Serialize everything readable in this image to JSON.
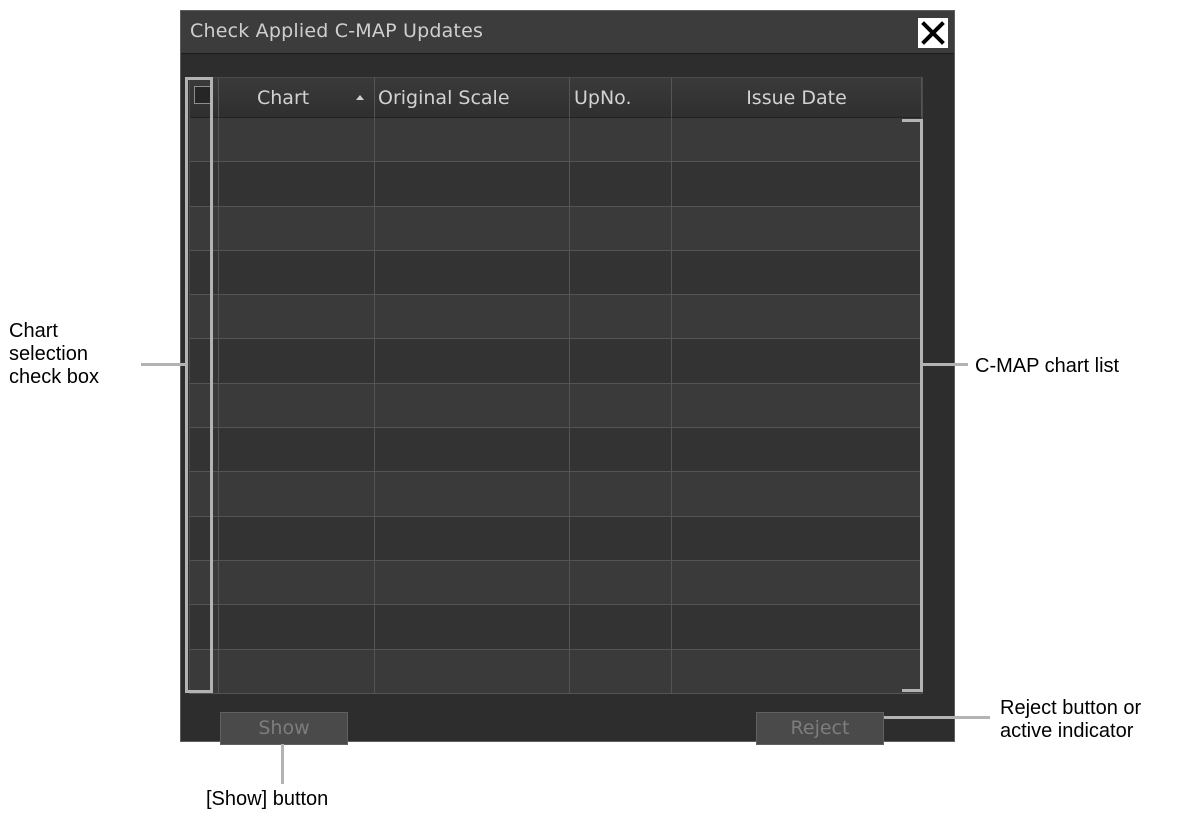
{
  "dialog": {
    "title": "Check Applied C-MAP Updates",
    "close_icon": "close-x-icon"
  },
  "table": {
    "columns": [
      {
        "label": "Chart",
        "sort": "ascending"
      },
      {
        "label": "Original Scale"
      },
      {
        "label": "UpNo."
      },
      {
        "label": "Issue Date"
      }
    ],
    "rows": [
      {
        "chart": "",
        "original_scale": "",
        "upno": "",
        "issue_date": ""
      },
      {
        "chart": "",
        "original_scale": "",
        "upno": "",
        "issue_date": ""
      },
      {
        "chart": "",
        "original_scale": "",
        "upno": "",
        "issue_date": ""
      },
      {
        "chart": "",
        "original_scale": "",
        "upno": "",
        "issue_date": ""
      },
      {
        "chart": "",
        "original_scale": "",
        "upno": "",
        "issue_date": ""
      },
      {
        "chart": "",
        "original_scale": "",
        "upno": "",
        "issue_date": ""
      },
      {
        "chart": "",
        "original_scale": "",
        "upno": "",
        "issue_date": ""
      },
      {
        "chart": "",
        "original_scale": "",
        "upno": "",
        "issue_date": ""
      },
      {
        "chart": "",
        "original_scale": "",
        "upno": "",
        "issue_date": ""
      },
      {
        "chart": "",
        "original_scale": "",
        "upno": "",
        "issue_date": ""
      },
      {
        "chart": "",
        "original_scale": "",
        "upno": "",
        "issue_date": ""
      },
      {
        "chart": "",
        "original_scale": "",
        "upno": "",
        "issue_date": ""
      },
      {
        "chart": "",
        "original_scale": "",
        "upno": "",
        "issue_date": ""
      }
    ]
  },
  "buttons": {
    "show_label": "Show",
    "reject_label": "Reject"
  },
  "annotations": {
    "checkbox_label": "Chart\nselection\ncheck box",
    "list_label": "C-MAP chart list",
    "reject_label": "Reject button or\nactive indicator",
    "show_label": "[Show] button"
  },
  "colors": {
    "dialog_bg": "#2d2d2d",
    "title_bg": "#3c3c3c",
    "annotation_bracket": "#b3b3b3"
  }
}
